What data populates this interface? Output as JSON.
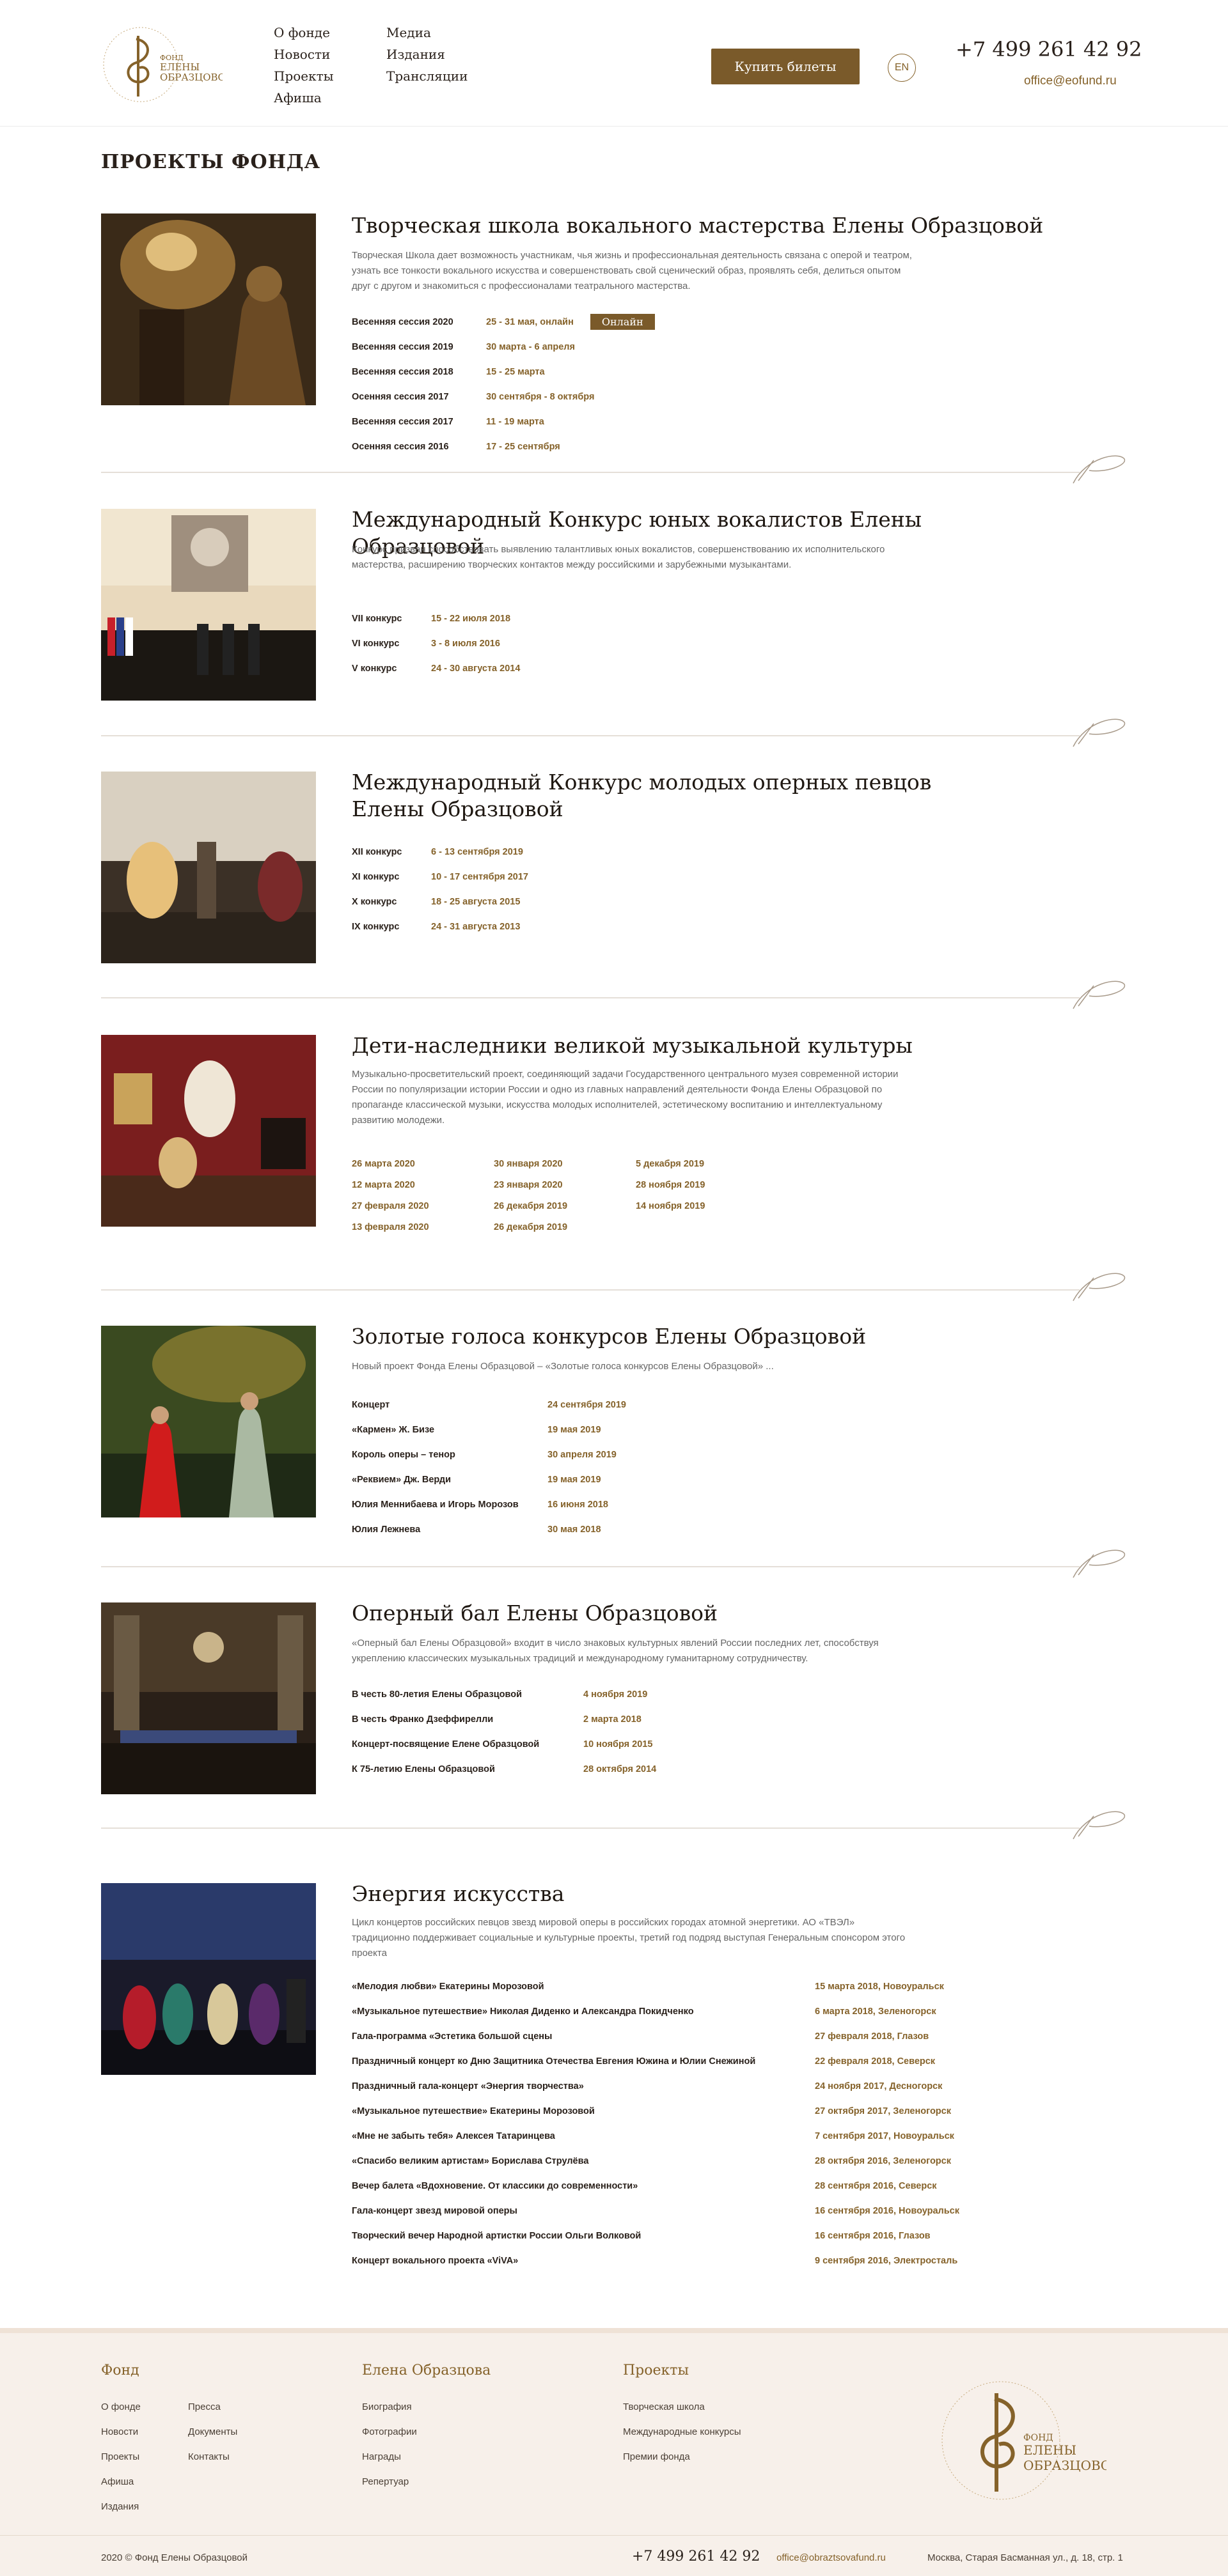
{
  "header": {
    "logo_text": [
      "ФОНД",
      "ЕЛЕНЫ",
      "ОБРАЗЦОВОЙ"
    ],
    "nav_col1": [
      "О фонде",
      "Новости",
      "Проекты",
      "Афиша"
    ],
    "nav_col2": [
      "Медиа",
      "Издания",
      "Трансляции"
    ],
    "buy_button": "Купить билеты",
    "lang": "EN",
    "phone": "+7 499 261 42 92",
    "email": "office@eofund.ru"
  },
  "page_title": "ПРОЕКТЫ ФОНДА",
  "colors": {
    "accent": "#85622a",
    "button": "#7a5a2a",
    "footer_bg": "#f7f0ea"
  },
  "projects": [
    {
      "title": "Творческая школа вокального мастерства Елены Образцовой",
      "description": "Творческая Школа дает возможность участникам, чья жизнь и профессиональная деятельность связана с оперой и театром, узнать все тонкости вокального искусства и совершенствовать свой сценический образ, проявлять себя, делиться опытом друг с другом и знакомиться с профессионалами театрального мастерства.",
      "badge": "Онлайн",
      "rows": [
        {
          "label": "Весенняя сессия 2020",
          "value": "25 - 31 мая, онлайн"
        },
        {
          "label": "Весенняя сессия 2019",
          "value": "30 марта - 6 апреля"
        },
        {
          "label": "Весенняя сессия 2018",
          "value": "15 - 25 марта"
        },
        {
          "label": "Осенняя сессия 2017",
          "value": "30 сентября - 8 октября"
        },
        {
          "label": "Весенняя сессия 2017",
          "value": "11 - 19 марта"
        },
        {
          "label": "Осенняя сессия 2016",
          "value": "17 - 25 сентября"
        }
      ]
    },
    {
      "title": "Международный Конкурс юных вокалистов Елены Образцовой",
      "description": "Конкурс призван способствовать выявлению талантливых юных вокалистов, совершенствованию их исполнительского мастерства, расширению творческих контактов между российскими и зарубежными музыкантами.",
      "rows": [
        {
          "label": "VII конкурс",
          "value": "15 - 22 июля 2018"
        },
        {
          "label": "VI конкурс",
          "value": "3 - 8 июля 2016"
        },
        {
          "label": "V конкурс",
          "value": "24 - 30 августа 2014"
        }
      ]
    },
    {
      "title_lines": [
        "Международный Конкурс молодых оперных певцов",
        "Елены Образцовой"
      ],
      "rows": [
        {
          "label": "XII конкурс",
          "value": "6 - 13 сентября 2019"
        },
        {
          "label": "XI конкурс",
          "value": "10 - 17 сентября 2017"
        },
        {
          "label": "X конкурс",
          "value": "18 - 25 августа 2015"
        },
        {
          "label": "IX конкурс",
          "value": "24 - 31 августа 2013"
        }
      ]
    },
    {
      "title": "Дети-наследники великой музыкальной культуры",
      "description": "Музыкально-просветительский проект, соединяющий задачи Государственного центрального музея современной истории России по популяризации истории России и одно из главных направлений деятельности Фонда Елены Образцовой по пропаганде классической музыки, искусства молодых исполнителей, эстетическому воспитанию и интеллектуальному развитию молодежи.",
      "dates": [
        "26 марта 2020",
        "30 января 2020",
        "5 декабря 2019",
        "12 марта 2020",
        "23 января 2020",
        "28 ноября 2019",
        "27 февраля 2020",
        "26 декабря 2019",
        "14 ноября 2019",
        "13 февраля 2020",
        "26 декабря 2019"
      ]
    },
    {
      "title": "Золотые голоса конкурсов Елены Образцовой",
      "description": "Новый проект Фонда Елены Образцовой – «Золотые голоса конкурсов Елены Образцовой» ...",
      "rows": [
        {
          "label": "Концерт",
          "value": "24 сентября 2019"
        },
        {
          "label": "«Кармен» Ж. Бизе",
          "value": "19 мая 2019"
        },
        {
          "label": "Король оперы – тенор",
          "value": "30 апреля 2019"
        },
        {
          "label": "«Реквием» Дж. Верди",
          "value": "19 мая 2019"
        },
        {
          "label": "Юлия Меннибаева и Игорь Морозов",
          "value": "16 июня 2018"
        },
        {
          "label": "Юлия Лежнева",
          "value": "30 мая 2018"
        }
      ]
    },
    {
      "title": "Оперный бал Елены Образцовой",
      "description": "«Оперный бал Елены Образцовой» входит в число знаковых культурных явлений России последних лет, способствуя укреплению классических музыкальных традиций и международному гуманитарному сотрудничеству.",
      "rows": [
        {
          "label": "В честь 80-летия Елены Образцовой",
          "value": "4 ноября 2019"
        },
        {
          "label": "В честь Франко Дзеффирелли",
          "value": "2 марта 2018"
        },
        {
          "label": "Концерт-посвящение Елене Образцовой",
          "value": "10 ноября 2015"
        },
        {
          "label": "К 75-летию Елены Образцовой",
          "value": "28 октября 2014"
        }
      ]
    },
    {
      "title": "Энергия искусства",
      "description": "Цикл концертов российских певцов звезд мировой оперы в российских городах атомной энергетики. АО «ТВЭЛ» традиционно поддерживает социальные и культурные проекты, третий год подряд выступая Генеральным спонсором этого проекта",
      "rows": [
        {
          "label": "«Мелодия любви» Екатерины Морозовой",
          "value": "15 марта 2018, Новоуральск"
        },
        {
          "label": "«Музыкальное путешествие» Николая Диденко и Александра Покидченко",
          "value": "6 марта 2018, Зеленогорск"
        },
        {
          "label": "Гала-программа «Эстетика большой сцены",
          "value": "27 февраля 2018, Глазов"
        },
        {
          "label": "Праздничный концерт ко Дню Защитника Отечества Евгения Южина и Юлии Снежиной",
          "value": "22 февраля 2018, Северск"
        },
        {
          "label": "Праздничный гала-концерт «Энергия творчества»",
          "value": "24 ноября 2017, Десногорск"
        },
        {
          "label": "«Музыкальное путешествие» Екатерины Морозовой",
          "value": "27 октября 2017, Зеленогорск"
        },
        {
          "label": "«Мне не забыть тебя» Алексея Татаринцева",
          "value": "7 сентября 2017, Новоуральск"
        },
        {
          "label": "«Спасибо великим артистам» Бориславa Струлёва",
          "value": "28 октября 2016, Зеленогорск"
        },
        {
          "label": "Вечер балета «Вдохновение. От классики до современности»",
          "value": "28 сентября 2016, Северск"
        },
        {
          "label": "Гала-концерт звезд мировой оперы",
          "value": "16 сентября 2016, Новоуральск"
        },
        {
          "label": "Творческий вечер Народной артистки России Ольги Волковой",
          "value": "16 сентября 2016, Глазов"
        },
        {
          "label": "Концерт вокального проекта «ViVA»",
          "value": "9 сентября 2016, Электросталь"
        }
      ]
    }
  ],
  "footer": {
    "col1_title": "Фонд",
    "col1a": [
      "О фонде",
      "Новости",
      "Проекты",
      "Афиша",
      "Издания"
    ],
    "col1b": [
      "Пресса",
      "Документы",
      "Контакты"
    ],
    "col2_title": "Елена Образцова",
    "col2": [
      "Биография",
      "Фотографии",
      "Награды",
      "Репертуар"
    ],
    "col3_title": "Проекты",
    "col3": [
      "Творческая школа",
      "Международные конкурсы",
      "Премии фонда"
    ],
    "copyright": "2020 © Фонд Елены Образцовой",
    "phone": "+7 499 261 42 92",
    "email": "office@obraztsovafund.ru",
    "address": "Москва, Старая Басманная ул., д. 18, стр. 1"
  }
}
